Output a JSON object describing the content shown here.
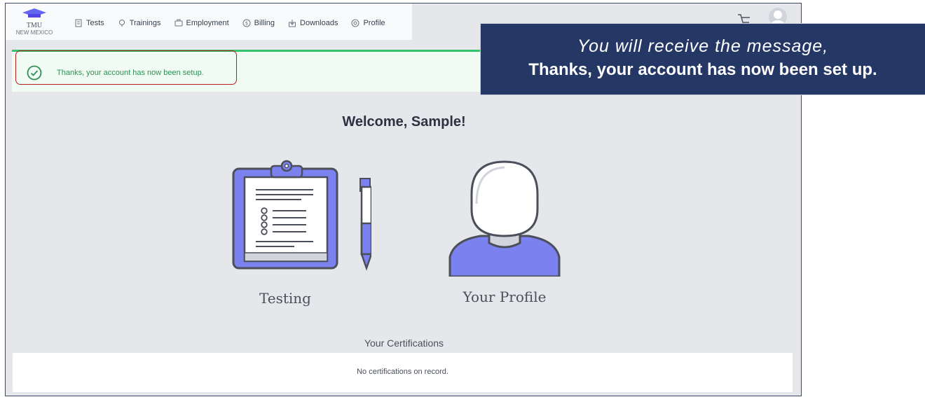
{
  "brand": {
    "name": "TMU",
    "subtitle": "NEW MEXICO"
  },
  "nav": [
    {
      "label": "Tests",
      "icon": "tests-icon"
    },
    {
      "label": "Trainings",
      "icon": "trainings-icon"
    },
    {
      "label": "Employment",
      "icon": "employment-icon"
    },
    {
      "label": "Billing",
      "icon": "billing-icon"
    },
    {
      "label": "Downloads",
      "icon": "downloads-icon"
    },
    {
      "label": "Profile",
      "icon": "profile-icon"
    }
  ],
  "alert": {
    "message": "Thanks, your account has now been setup."
  },
  "welcome": "Welcome, Sample!",
  "cards": {
    "testing": "Testing",
    "profile": "Your Profile"
  },
  "certifications": {
    "title": "Your Certifications",
    "empty": "No certifications on record."
  },
  "callout": {
    "line1": "You will receive the message,",
    "line2": "Thanks, your account has now been set up."
  },
  "colors": {
    "accent": "#7b82f0",
    "success": "#34c26a",
    "callout_bg": "#253764",
    "highlight": "#b91c1c"
  }
}
